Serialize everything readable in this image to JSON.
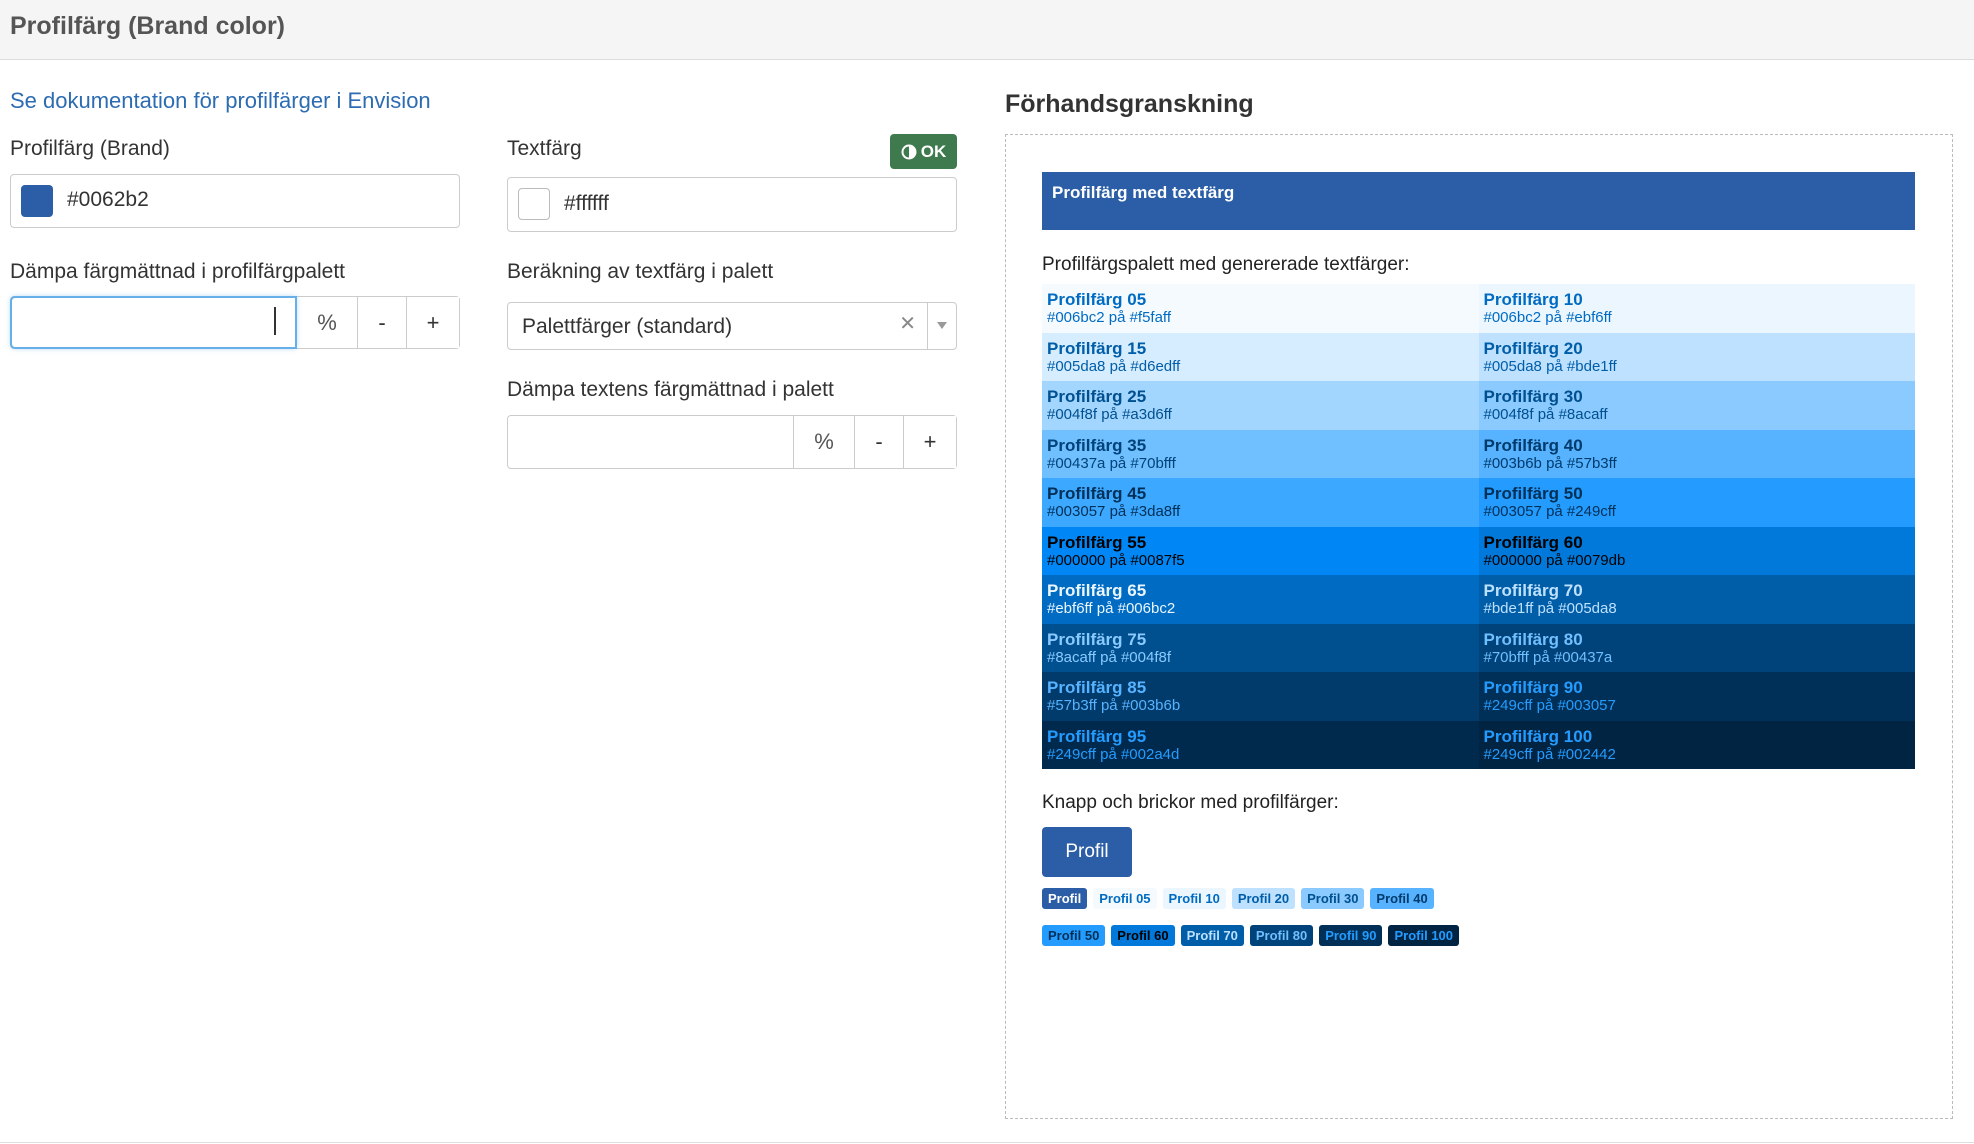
{
  "header": {
    "title": "Profilfärg (Brand color)"
  },
  "left": {
    "doc_link": "Se dokumentation för profilfärger i Envision",
    "brand_label": "Profilfärg (Brand)",
    "brand_value": "#0062b2",
    "brand_swatch_color": "#2b5ea7",
    "text_color_label": "Textfärg",
    "text_color_value": "#ffffff",
    "ok_badge": "OK",
    "saturation_label": "Dämpa färgmättnad i profilfärgpalett",
    "calc_label": "Beräkning av textfärg i palett",
    "calc_select_value": "Palettfärger (standard)",
    "text_saturation_label": "Dämpa textens färgmättnad i palett",
    "percent": "%",
    "minus": "-",
    "plus": "+"
  },
  "preview": {
    "title": "Förhandsgranskning",
    "banner": {
      "label": "Profilfärg med textfärg",
      "bg": "#2b5ea7",
      "fg": "#ffffff"
    },
    "palette_heading": "Profilfärgspalett med genererade textfärger:",
    "palette": [
      {
        "name": "Profilfärg 05",
        "info": "#006bc2 på #f5faff",
        "bg": "#f5faff",
        "fg": "#006bc2"
      },
      {
        "name": "Profilfärg 10",
        "info": "#006bc2 på #ebf6ff",
        "bg": "#ebf6ff",
        "fg": "#006bc2"
      },
      {
        "name": "Profilfärg 15",
        "info": "#005da8 på #d6edff",
        "bg": "#d6edff",
        "fg": "#005da8"
      },
      {
        "name": "Profilfärg 20",
        "info": "#005da8 på #bde1ff",
        "bg": "#bde1ff",
        "fg": "#005da8"
      },
      {
        "name": "Profilfärg 25",
        "info": "#004f8f på #a3d6ff",
        "bg": "#a3d6ff",
        "fg": "#004f8f"
      },
      {
        "name": "Profilfärg 30",
        "info": "#004f8f på #8acaff",
        "bg": "#8acaff",
        "fg": "#004f8f"
      },
      {
        "name": "Profilfärg 35",
        "info": "#00437a på #70bfff",
        "bg": "#70bfff",
        "fg": "#00437a"
      },
      {
        "name": "Profilfärg 40",
        "info": "#003b6b på #57b3ff",
        "bg": "#57b3ff",
        "fg": "#003b6b"
      },
      {
        "name": "Profilfärg 45",
        "info": "#003057 på #3da8ff",
        "bg": "#3da8ff",
        "fg": "#003057"
      },
      {
        "name": "Profilfärg 50",
        "info": "#003057 på #249cff",
        "bg": "#249cff",
        "fg": "#003057"
      },
      {
        "name": "Profilfärg 55",
        "info": "#000000 på #0087f5",
        "bg": "#0087f5",
        "fg": "#000000"
      },
      {
        "name": "Profilfärg 60",
        "info": "#000000 på #0079db",
        "bg": "#0079db",
        "fg": "#000000"
      },
      {
        "name": "Profilfärg 65",
        "info": "#ebf6ff på #006bc2",
        "bg": "#006bc2",
        "fg": "#ebf6ff"
      },
      {
        "name": "Profilfärg 70",
        "info": "#bde1ff på #005da8",
        "bg": "#005da8",
        "fg": "#bde1ff"
      },
      {
        "name": "Profilfärg 75",
        "info": "#8acaff på #004f8f",
        "bg": "#004f8f",
        "fg": "#8acaff"
      },
      {
        "name": "Profilfärg 80",
        "info": "#70bfff på #00437a",
        "bg": "#00437a",
        "fg": "#70bfff"
      },
      {
        "name": "Profilfärg 85",
        "info": "#57b3ff på #003b6b",
        "bg": "#003b6b",
        "fg": "#57b3ff"
      },
      {
        "name": "Profilfärg 90",
        "info": "#249cff på #003057",
        "bg": "#003057",
        "fg": "#249cff"
      },
      {
        "name": "Profilfärg 95",
        "info": "#249cff på #002a4d",
        "bg": "#002a4d",
        "fg": "#249cff"
      },
      {
        "name": "Profilfärg 100",
        "info": "#249cff på #002442",
        "bg": "#002442",
        "fg": "#249cff"
      }
    ],
    "buttons_heading": "Knapp och brickor med profilfärger:",
    "profil_button": {
      "label": "Profil",
      "bg": "#2b5ea7",
      "fg": "#ffffff"
    },
    "badges_row1": [
      {
        "label": "Profil",
        "bg": "#2b5ea7",
        "fg": "#ffffff"
      },
      {
        "label": "Profil 05",
        "bg": "#f5faff",
        "fg": "#006bc2"
      },
      {
        "label": "Profil 10",
        "bg": "#ebf6ff",
        "fg": "#006bc2"
      },
      {
        "label": "Profil 20",
        "bg": "#bde1ff",
        "fg": "#005da8"
      },
      {
        "label": "Profil 30",
        "bg": "#8acaff",
        "fg": "#004f8f"
      },
      {
        "label": "Profil 40",
        "bg": "#57b3ff",
        "fg": "#003b6b"
      }
    ],
    "badges_row2": [
      {
        "label": "Profil 50",
        "bg": "#249cff",
        "fg": "#003057"
      },
      {
        "label": "Profil 60",
        "bg": "#0079db",
        "fg": "#000000"
      },
      {
        "label": "Profil 70",
        "bg": "#005da8",
        "fg": "#bde1ff"
      },
      {
        "label": "Profil 80",
        "bg": "#00437a",
        "fg": "#70bfff"
      },
      {
        "label": "Profil 90",
        "bg": "#003057",
        "fg": "#249cff"
      },
      {
        "label": "Profil 100",
        "bg": "#002442",
        "fg": "#249cff"
      }
    ]
  }
}
